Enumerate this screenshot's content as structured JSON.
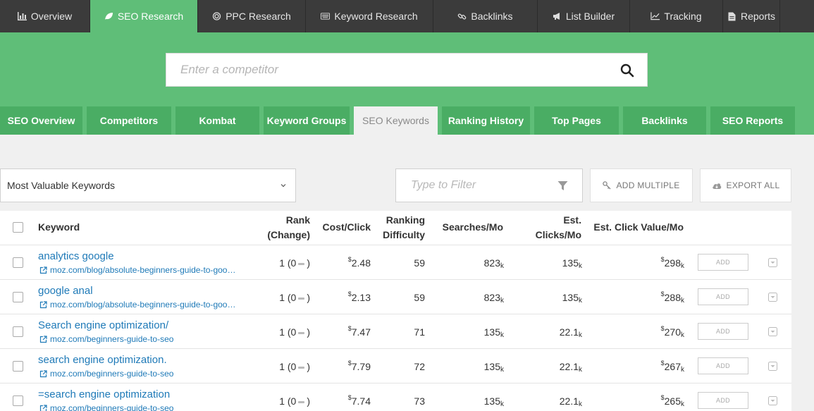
{
  "top_nav": [
    {
      "label": "Overview",
      "icon": "bar-chart-icon"
    },
    {
      "label": "SEO Research",
      "icon": "leaf-icon",
      "active": true
    },
    {
      "label": "PPC Research",
      "icon": "target-icon"
    },
    {
      "label": "Keyword Research",
      "icon": "keyboard-icon"
    },
    {
      "label": "Backlinks",
      "icon": "link-icon"
    },
    {
      "label": "List Builder",
      "icon": "megaphone-icon"
    },
    {
      "label": "Tracking",
      "icon": "line-chart-icon"
    },
    {
      "label": "Reports",
      "icon": "document-icon"
    }
  ],
  "search": {
    "placeholder": "Enter a competitor"
  },
  "sub_nav": [
    {
      "label": "SEO Overview"
    },
    {
      "label": "Competitors"
    },
    {
      "label": "Kombat"
    },
    {
      "label": "Keyword Groups"
    },
    {
      "label": "SEO Keywords",
      "active": true
    },
    {
      "label": "Ranking History"
    },
    {
      "label": "Top Pages"
    },
    {
      "label": "Backlinks"
    },
    {
      "label": "SEO Reports"
    }
  ],
  "controls": {
    "view_select": "Most Valuable Keywords",
    "filter_placeholder": "Type to Filter",
    "add_multiple": "ADD MULTIPLE",
    "export_all": "EXPORT ALL"
  },
  "table": {
    "headers": {
      "keyword": "Keyword",
      "rank_1": "Rank",
      "rank_2": "(Change)",
      "cost": "Cost/Click",
      "difficulty_1": "Ranking",
      "difficulty_2": "Difficulty",
      "searches": "Searches/Mo",
      "clicks_1": "Est.",
      "clicks_2": "Clicks/Mo",
      "click_value": "Est. Click Value/Mo"
    },
    "add_label": "ADD",
    "rows": [
      {
        "keyword": "analytics google",
        "url": "moz.com/blog/absolute-beginners-guide-to-goo…",
        "rank": "1 (0",
        "rank_close": ")",
        "cost_sym": "$",
        "cost": "2.48",
        "difficulty": "59",
        "searches": "823",
        "searches_suf": "k",
        "clicks": "135",
        "clicks_suf": "k",
        "value_sym": "$",
        "value": "298",
        "value_suf": "k"
      },
      {
        "keyword": "google anal",
        "url": "moz.com/blog/absolute-beginners-guide-to-goo…",
        "rank": "1 (0",
        "rank_close": ")",
        "cost_sym": "$",
        "cost": "2.13",
        "difficulty": "59",
        "searches": "823",
        "searches_suf": "k",
        "clicks": "135",
        "clicks_suf": "k",
        "value_sym": "$",
        "value": "288",
        "value_suf": "k"
      },
      {
        "keyword": "Search engine optimization/",
        "url": "moz.com/beginners-guide-to-seo",
        "rank": "1 (0",
        "rank_close": ")",
        "cost_sym": "$",
        "cost": "7.47",
        "difficulty": "71",
        "searches": "135",
        "searches_suf": "k",
        "clicks": "22.1",
        "clicks_suf": "k",
        "value_sym": "$",
        "value": "270",
        "value_suf": "k"
      },
      {
        "keyword": "search engine optimization.",
        "url": "moz.com/beginners-guide-to-seo",
        "rank": "1 (0",
        "rank_close": ")",
        "cost_sym": "$",
        "cost": "7.79",
        "difficulty": "72",
        "searches": "135",
        "searches_suf": "k",
        "clicks": "22.1",
        "clicks_suf": "k",
        "value_sym": "$",
        "value": "267",
        "value_suf": "k"
      },
      {
        "keyword": "=search engine optimization",
        "url": "moz.com/beginners-guide-to-seo",
        "rank": "1 (0",
        "rank_close": ")",
        "cost_sym": "$",
        "cost": "7.74",
        "difficulty": "73",
        "searches": "135",
        "searches_suf": "k",
        "clicks": "22.1",
        "clicks_suf": "k",
        "value_sym": "$",
        "value": "265",
        "value_suf": "k"
      }
    ]
  },
  "colors": {
    "brand_green": "#5fbe78",
    "tab_green": "#4aad64",
    "nav_dark": "#3b3b3b",
    "link_blue": "#1f7ab8"
  }
}
